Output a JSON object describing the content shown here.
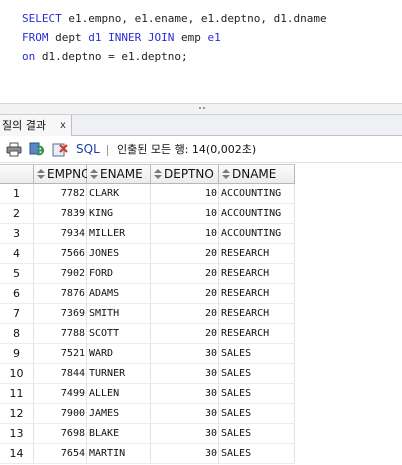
{
  "editor": {
    "lines": [
      [
        {
          "t": "SELECT",
          "kw": true
        },
        {
          "t": " e1.empno, e1.ename, e1.deptno, d1.dname",
          "kw": false
        }
      ],
      [
        {
          "t": "FROM",
          "kw": true
        },
        {
          "t": " dept ",
          "kw": false
        },
        {
          "t": "d1",
          "kw": true
        },
        {
          "t": " ",
          "kw": false
        },
        {
          "t": "INNER JOIN",
          "kw": true
        },
        {
          "t": " emp ",
          "kw": false
        },
        {
          "t": "e1",
          "kw": true
        }
      ],
      [
        {
          "t": "on",
          "kw": true
        },
        {
          "t": " d1.deptno = e1.deptno;",
          "kw": false
        }
      ]
    ]
  },
  "result_tab": {
    "label": "질의 결과",
    "close": "x"
  },
  "toolbar": {
    "icons": [
      "print-icon",
      "refresh-icon",
      "export-icon"
    ],
    "sql_label": "SQL",
    "status": "인출된 모든 행: 14(0,002초)"
  },
  "grid": {
    "columns": [
      "EMPNO",
      "ENAME",
      "DEPTNO",
      "DNAME"
    ],
    "rows": [
      {
        "n": "1",
        "empno": "7782",
        "ename": "CLARK",
        "deptno": "10",
        "dname": "ACCOUNTING"
      },
      {
        "n": "2",
        "empno": "7839",
        "ename": "KING",
        "deptno": "10",
        "dname": "ACCOUNTING"
      },
      {
        "n": "3",
        "empno": "7934",
        "ename": "MILLER",
        "deptno": "10",
        "dname": "ACCOUNTING"
      },
      {
        "n": "4",
        "empno": "7566",
        "ename": "JONES",
        "deptno": "20",
        "dname": "RESEARCH"
      },
      {
        "n": "5",
        "empno": "7902",
        "ename": "FORD",
        "deptno": "20",
        "dname": "RESEARCH"
      },
      {
        "n": "6",
        "empno": "7876",
        "ename": "ADAMS",
        "deptno": "20",
        "dname": "RESEARCH"
      },
      {
        "n": "7",
        "empno": "7369",
        "ename": "SMITH",
        "deptno": "20",
        "dname": "RESEARCH"
      },
      {
        "n": "8",
        "empno": "7788",
        "ename": "SCOTT",
        "deptno": "20",
        "dname": "RESEARCH"
      },
      {
        "n": "9",
        "empno": "7521",
        "ename": "WARD",
        "deptno": "30",
        "dname": "SALES"
      },
      {
        "n": "10",
        "empno": "7844",
        "ename": "TURNER",
        "deptno": "30",
        "dname": "SALES"
      },
      {
        "n": "11",
        "empno": "7499",
        "ename": "ALLEN",
        "deptno": "30",
        "dname": "SALES"
      },
      {
        "n": "12",
        "empno": "7900",
        "ename": "JAMES",
        "deptno": "30",
        "dname": "SALES"
      },
      {
        "n": "13",
        "empno": "7698",
        "ename": "BLAKE",
        "deptno": "30",
        "dname": "SALES"
      },
      {
        "n": "14",
        "empno": "7654",
        "ename": "MARTIN",
        "deptno": "30",
        "dname": "SALES"
      }
    ]
  },
  "colors": {
    "keyword": "#2b2bd6",
    "sql_link": "#1f3fa5"
  }
}
